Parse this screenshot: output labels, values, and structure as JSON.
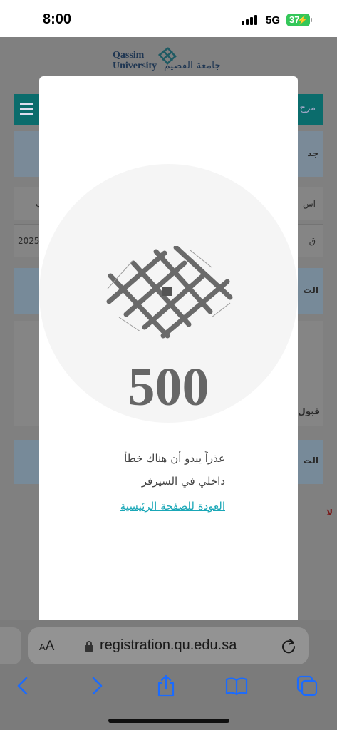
{
  "status_bar": {
    "time": "8:00",
    "network": "5G",
    "battery": "37"
  },
  "background_page": {
    "logo_latin": "Qassim\nUniversity",
    "logo_arabic": "جامعة القصيم",
    "nav_text": "مرح",
    "card_title": "جد",
    "row1_right": "اس",
    "row1_left": "ب",
    "row2_left": "2025-",
    "row2_right": "ق",
    "section1": "الت",
    "accept_text": "قبول",
    "section2": "الت",
    "warning": "لا"
  },
  "error_modal": {
    "code": "500",
    "message_line1": "عذراً يبدو أن هناك خطأ",
    "message_line2": "داخلي في السيرفر",
    "home_link": "العودة للصفحة الرئيسية"
  },
  "browser": {
    "text_size_label_small": "A",
    "text_size_label_big": "A",
    "url": "registration.qu.edu.sa",
    "icons": [
      "back-icon",
      "forward-icon",
      "share-icon",
      "bookmarks-icon",
      "tabs-icon",
      "reload-icon",
      "lock-icon"
    ],
    "accent_color": "#1a6bff"
  }
}
